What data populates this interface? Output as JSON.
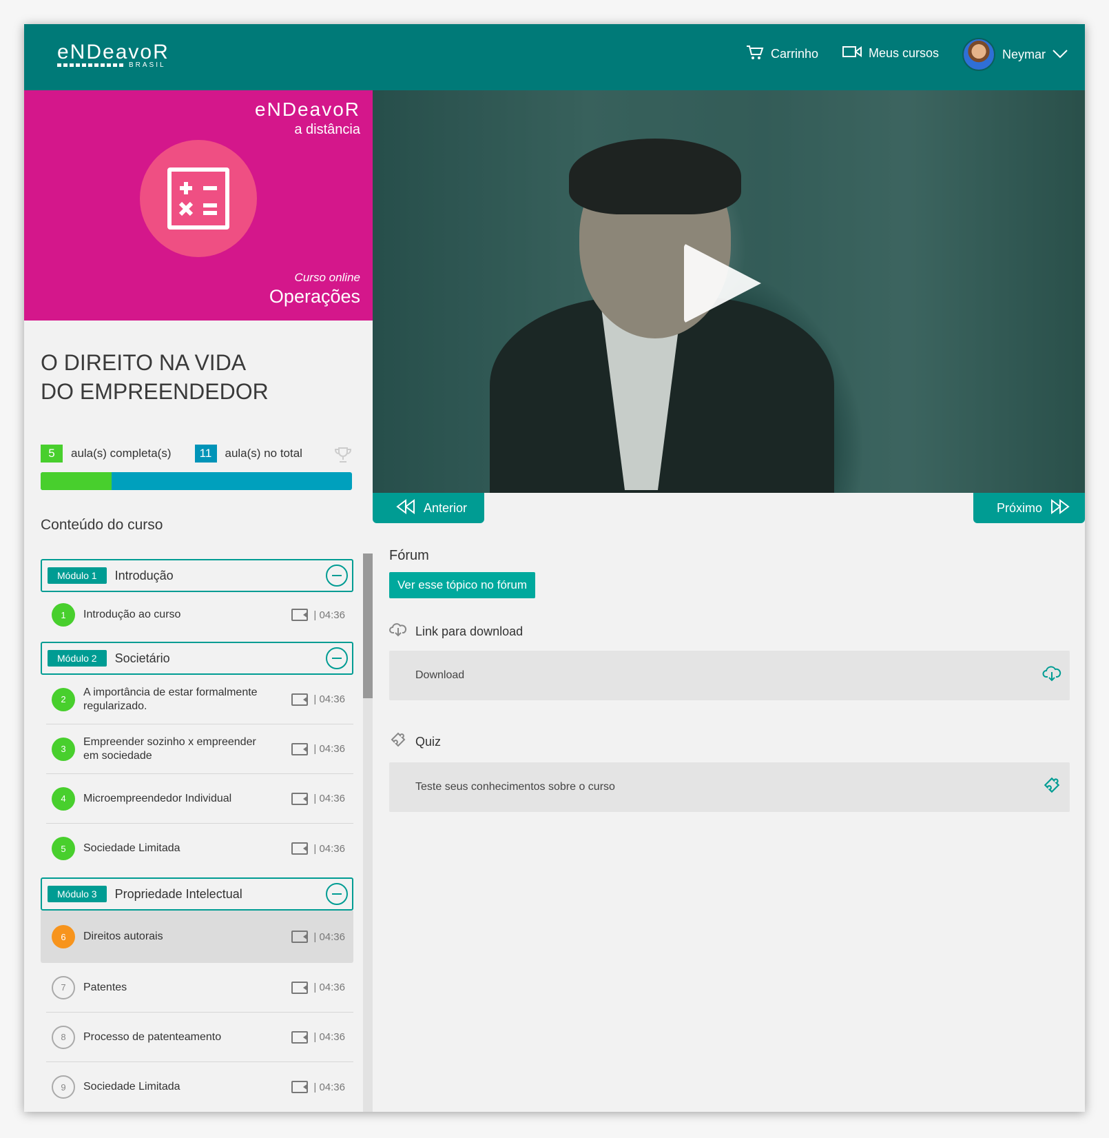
{
  "header": {
    "logo_word": "eNDeavoR",
    "logo_sub": "BRASIL",
    "cart_label": "Carrinho",
    "my_courses_label": "Meus cursos",
    "user_name": "Neymar"
  },
  "banner": {
    "logo_word": "eNDeavoR",
    "logo_sub": "a distância",
    "kicker": "Curso online",
    "title": "Operações"
  },
  "course": {
    "title_line1": "O DIREITO NA VIDA",
    "title_line2": "DO EMPREENDEDOR",
    "completed_count": "5",
    "completed_label": "aula(s) completa(s)",
    "total_count": "11",
    "total_label": "aula(s) no total",
    "progress_fraction": 0.2273,
    "contents_title": "Conteúdo do curso"
  },
  "video_nav": {
    "prev_label": "Anterior",
    "next_label": "Próximo"
  },
  "modules": [
    {
      "tag": "Módulo 1",
      "name": "Introdução",
      "lessons": [
        {
          "num": "1",
          "title": "Introdução ao curso",
          "duration": "| 04:36",
          "status": "done"
        }
      ]
    },
    {
      "tag": "Módulo 2",
      "name": "Societário",
      "lessons": [
        {
          "num": "2",
          "title": "A importância de estar formalmente regularizado.",
          "duration": "| 04:36",
          "status": "done"
        },
        {
          "num": "3",
          "title": "Empreender sozinho x empreender em sociedade",
          "duration": "| 04:36",
          "status": "done"
        },
        {
          "num": "4",
          "title": "Microempreendedor Individual",
          "duration": "| 04:36",
          "status": "done"
        },
        {
          "num": "5",
          "title": "Sociedade Limitada",
          "duration": "| 04:36",
          "status": "done"
        }
      ]
    },
    {
      "tag": "Módulo 3",
      "name": "Propriedade Intelectual",
      "lessons": [
        {
          "num": "6",
          "title": "Direitos autorais",
          "duration": "| 04:36",
          "status": "current"
        },
        {
          "num": "7",
          "title": "Patentes",
          "duration": "| 04:36",
          "status": "todo"
        },
        {
          "num": "8",
          "title": "Processo de patenteamento",
          "duration": "| 04:36",
          "status": "todo"
        },
        {
          "num": "9",
          "title": "Sociedade Limitada",
          "duration": "| 04:36",
          "status": "todo"
        }
      ]
    }
  ],
  "forum": {
    "title": "Fórum",
    "button_label": "Ver esse tópico no fórum"
  },
  "download": {
    "heading": "Link para download",
    "item_label": "Download"
  },
  "quiz": {
    "heading": "Quiz",
    "item_label": "Teste seus conhecimentos sobre o curso"
  },
  "colors": {
    "header": "#007a78",
    "accent": "#009c93",
    "banner": "#d4178b",
    "done": "#48cf2d",
    "current": "#f7941d",
    "total": "#0094b8"
  }
}
